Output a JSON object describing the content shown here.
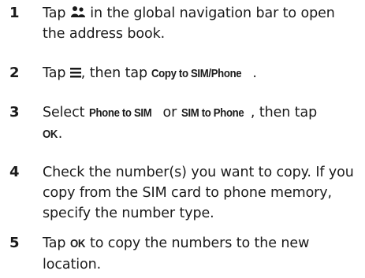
{
  "steps": [
    {
      "number": "1",
      "before_icon": "Tap",
      "icon": "contacts-icon",
      "after_icon": "in the global navigation bar to open the address book."
    },
    {
      "number": "2",
      "before_icon": "Tap",
      "icon": "menu-icon",
      "after_icon": ", then tap",
      "command": "Copy to SIM/Phone",
      "end": "."
    },
    {
      "number": "3",
      "pre": "Select",
      "command_a": "Phone to SIM",
      "mid": "or",
      "command_b": "SIM to Phone",
      "post": ", then tap",
      "command_c": "OK",
      "end": "."
    },
    {
      "number": "4",
      "text": "Check the number(s) you want to copy. If you copy from the SIM card to phone memory, specify the number type."
    },
    {
      "number": "5",
      "pre": "Tap",
      "command": "OK",
      "post": "to copy the numbers to the new location."
    }
  ]
}
